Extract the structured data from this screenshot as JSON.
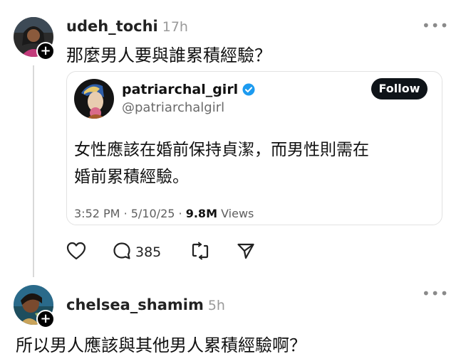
{
  "post1": {
    "username": "udeh_tochi",
    "time": "17h",
    "text": "那麼男人要與誰累積經驗？",
    "more_label": "•••"
  },
  "quote": {
    "display_name": "patriarchal_girl",
    "handle": "@patriarchalgirl",
    "follow_label": "Follow",
    "body_line1": "女性應該在婚前保持貞潔，而男性則需在",
    "body_line2": "婚前累積經驗。",
    "time": "3:52 PM",
    "date": "5/10/25",
    "views": "9.8M",
    "views_label": "Views",
    "sep": "·"
  },
  "actions": {
    "reply_count": "385"
  },
  "post2": {
    "username": "chelsea_shamim",
    "time": "5h",
    "text": "所以男人應該與其他男人累積經驗啊？",
    "more_label": "•••"
  },
  "colors": {
    "verified": "#1d9bf0",
    "follow_bg": "#0f1419"
  },
  "icons": [
    "plus-icon",
    "more-icon",
    "verified-icon",
    "heart-icon",
    "comment-icon",
    "repost-icon",
    "share-icon"
  ]
}
